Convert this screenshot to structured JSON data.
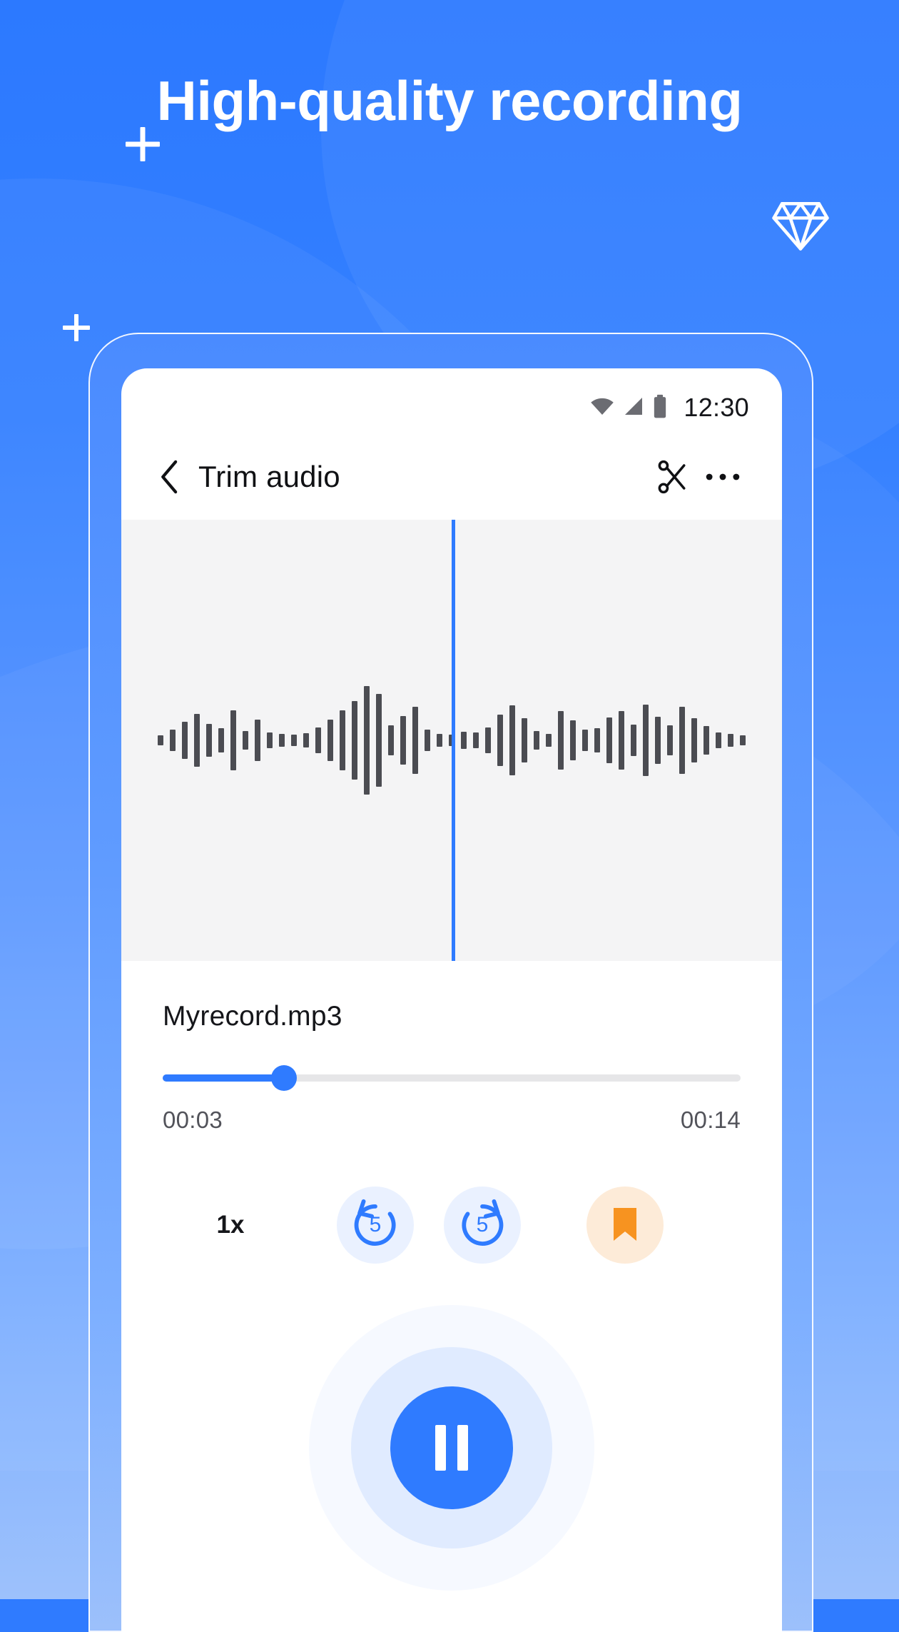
{
  "promo": {
    "headline": "High-quality recording",
    "decor": {
      "plus_1": "plus-mark",
      "plus_2": "plus-mark",
      "gem": "diamond-icon"
    },
    "colors": {
      "background_top": "#2c79ff",
      "background_bottom": "#9dc1fc",
      "accent": "#2f7bff",
      "bookmark": "#f79320"
    }
  },
  "phone": {
    "status_bar": {
      "wifi_icon": "wifi-icon",
      "signal_icon": "cellular-signal-icon",
      "battery_icon": "battery-icon",
      "time": "12:30"
    },
    "app_bar": {
      "back_icon": "chevron-left-icon",
      "title": "Trim audio",
      "cut_icon": "scissors-icon",
      "more_icon": "more-options-icon"
    },
    "waveform": {
      "playhead_percent": 50,
      "bar_color": "#4b4c52",
      "background": "#f4f4f5",
      "playhead_color": "#2f7bff",
      "bars": [
        14,
        30,
        52,
        74,
        46,
        34,
        84,
        26,
        58,
        22,
        18,
        16,
        20,
        36,
        58,
        84,
        110,
        152,
        130,
        42,
        68,
        94,
        30,
        18,
        16,
        24,
        22,
        36,
        72,
        98,
        62,
        26,
        18,
        82,
        56,
        30,
        34,
        64,
        82,
        44,
        100,
        66,
        42,
        94,
        62,
        40,
        22,
        18,
        14
      ]
    },
    "player": {
      "track_name": "Myrecord.mp3",
      "progress_percent": 21,
      "current_time": "00:03",
      "total_time": "00:14"
    },
    "controls": {
      "speed_label": "1x",
      "rewind": {
        "icon": "rewind-5-icon",
        "label": "5"
      },
      "forward": {
        "icon": "forward-5-icon",
        "label": "5"
      },
      "bookmark": {
        "icon": "bookmark-icon"
      },
      "playback": {
        "icon": "pause-icon",
        "state": "playing"
      }
    }
  }
}
